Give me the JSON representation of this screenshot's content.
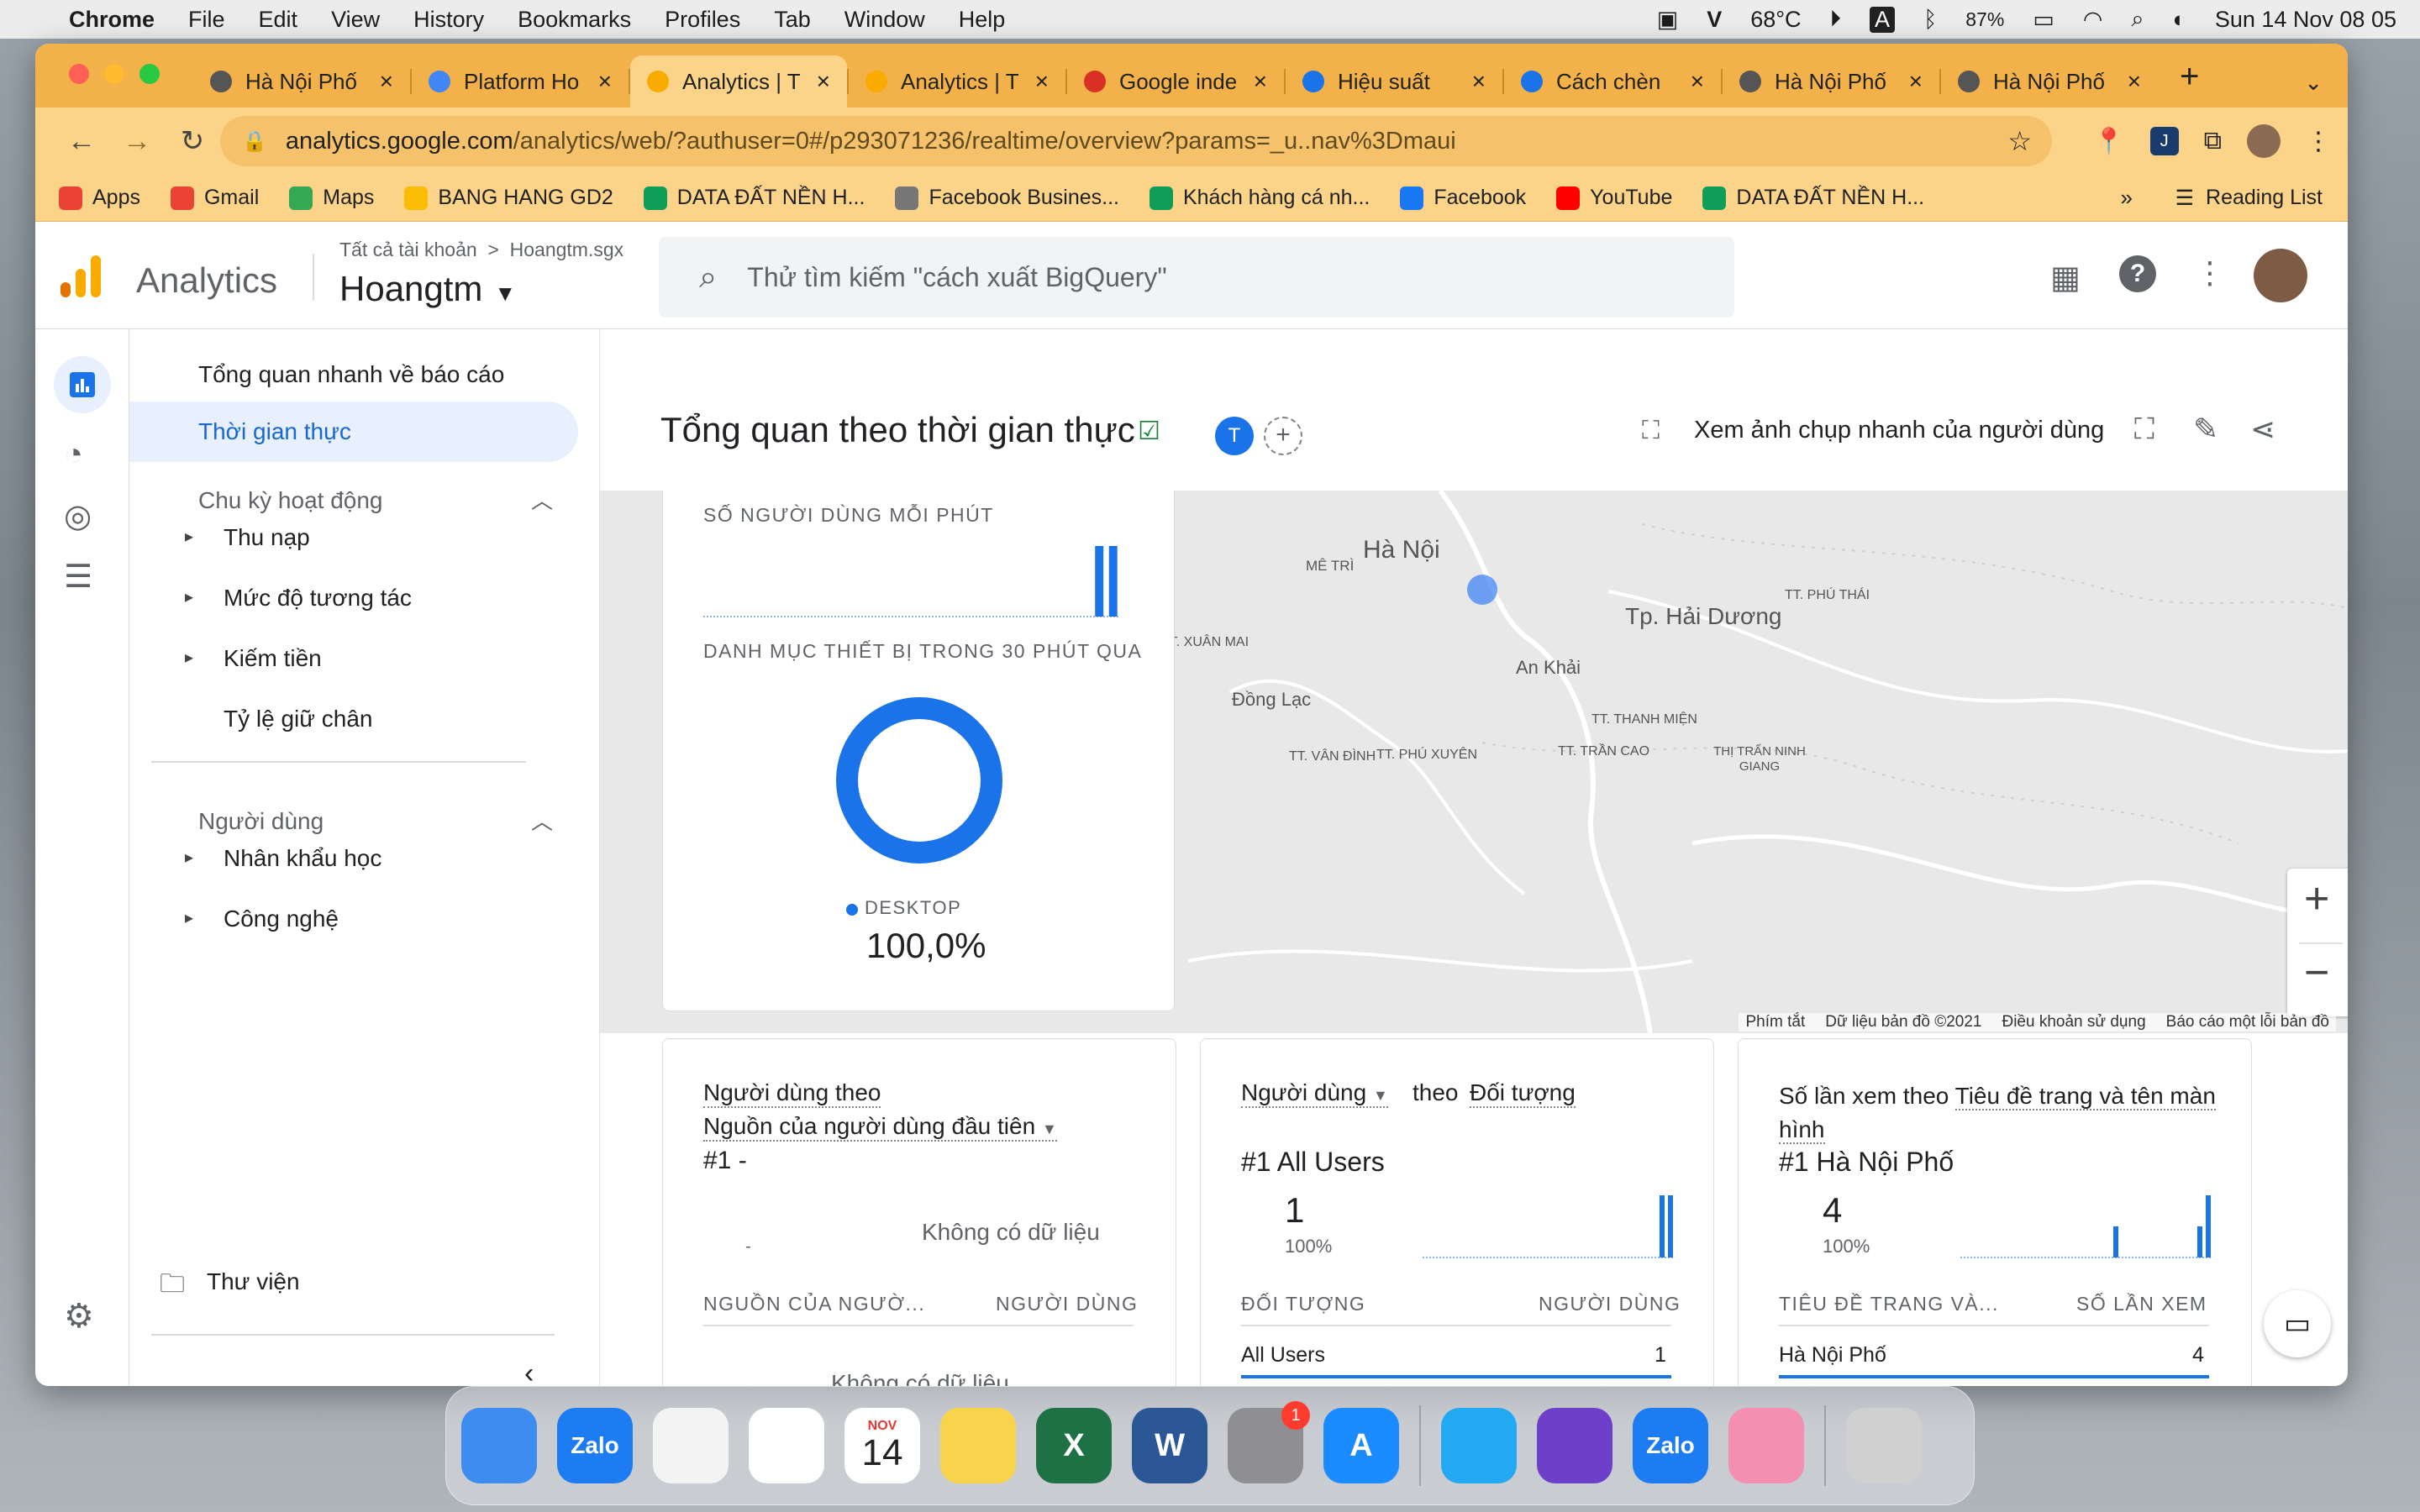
{
  "menubar": {
    "app": "Chrome",
    "items": [
      "File",
      "Edit",
      "View",
      "History",
      "Bookmarks",
      "Profiles",
      "Tab",
      "Window",
      "Help"
    ],
    "temp": "68°C",
    "battery": "87%",
    "datetime": "Sun 14 Nov  08 05"
  },
  "tabs": [
    {
      "title": "Hà Nội Phố",
      "color": "#555"
    },
    {
      "title": "Platform Ho",
      "color": "#4285f4"
    },
    {
      "title": "Analytics | T",
      "color": "#f9ab00"
    },
    {
      "title": "Analytics | T",
      "color": "#f9ab00"
    },
    {
      "title": "Google inde",
      "color": "#d93025"
    },
    {
      "title": "Hiệu suất",
      "color": "#1a73e8"
    },
    {
      "title": "Cách chèn",
      "color": "#1a73e8"
    },
    {
      "title": "Hà Nội Phố",
      "color": "#555"
    },
    {
      "title": "Hà Nội Phố",
      "color": "#555"
    }
  ],
  "url": {
    "domain": "analytics.google.com",
    "path": "/analytics/web/?authuser=0#/p293071236/realtime/overview?params=_u..nav%3Dmaui"
  },
  "bookmarks": [
    {
      "label": "Apps",
      "color": "#ea4335"
    },
    {
      "label": "Gmail",
      "color": "#ea4335"
    },
    {
      "label": "Maps",
      "color": "#34a853"
    },
    {
      "label": "BANG HANG GD2",
      "color": "#fbbc04"
    },
    {
      "label": "DATA ĐẤT NỀN H...",
      "color": "#0f9d58"
    },
    {
      "label": "Facebook Busines...",
      "color": "#777"
    },
    {
      "label": "Khách hàng cá nh...",
      "color": "#0f9d58"
    },
    {
      "label": "Facebook",
      "color": "#1877f2"
    },
    {
      "label": "YouTube",
      "color": "#ff0000"
    },
    {
      "label": "DATA ĐẤT NỀN H...",
      "color": "#0f9d58"
    }
  ],
  "reading_list": "Reading List",
  "ga": {
    "product": "Analytics",
    "breadcrumb": "Tất cả tài khoản  >  Hoangtm.sgx",
    "property": "Hoangtm",
    "search_placeholder": "Thử tìm kiếm \"cách xuất BigQuery\""
  },
  "nav": {
    "overview": "Tổng quan nhanh về báo cáo",
    "realtime": "Thời gian thực",
    "lifecycle": "Chu kỳ hoạt động",
    "acquisition": "Thu nạp",
    "engagement": "Mức độ tương tác",
    "monetization": "Kiếm tiền",
    "retention": "Tỷ lệ giữ chân",
    "users": "Người dùng",
    "demographics": "Nhân khẩu học",
    "tech": "Công nghệ",
    "library": "Thư viện"
  },
  "page": {
    "title": "Tổng quan theo thời gian thực",
    "avatar_letter": "T",
    "snapshot": "Xem ảnh chụp nhanh của người dùng"
  },
  "map": {
    "labels": [
      {
        "text": "Hà Nội",
        "size": 30
      },
      {
        "text": "MÊ TRÌ",
        "size": 17
      },
      {
        "text": "Tp. Hải Dương",
        "size": 28
      },
      {
        "text": "An Khải",
        "size": 22
      },
      {
        "text": "Đồng Lạc",
        "size": 22
      },
      {
        "text": "TT. XUÂN MAI",
        "size": 16
      },
      {
        "text": "TT. PHÚ THÁI",
        "size": 16
      },
      {
        "text": "TT. THANH MIỆN",
        "size": 16
      },
      {
        "text": "TT. VÂN ĐÌNH",
        "size": 16
      },
      {
        "text": "TT. PHÚ XUYÊN",
        "size": 16
      },
      {
        "text": "TT. TRẦN CAO",
        "size": 16
      },
      {
        "text": "THỊ TRẤN NINH GIANG",
        "size": 15
      }
    ],
    "footer": [
      "Phím tắt",
      "Dữ liệu bản đồ ©2021",
      "Điều khoản sử dụng",
      "Báo cáo một lỗi bản đồ"
    ]
  },
  "overlay": {
    "users_per_min": "SỐ NGƯỜI DÙNG MỖI PHÚT",
    "device_title": "DANH MỤC THIẾT BỊ TRONG 30 PHÚT QUA",
    "device_label": "DESKTOP",
    "device_value": "100,0%",
    "device_share": 1.0,
    "minute_bars": [
      0,
      0,
      0,
      0,
      0,
      0,
      0,
      0,
      0,
      0,
      0,
      0,
      0,
      0,
      0,
      0,
      0,
      0,
      0,
      0,
      0,
      0,
      0,
      0,
      0,
      0,
      0,
      0,
      1,
      1
    ]
  },
  "cards": [
    {
      "title_a": "Người dùng theo",
      "title_b": "Nguồn của người dùng đầu tiên",
      "rank": "#1  -",
      "empty": "Không có dữ liệu",
      "small_dash": "-",
      "col1": "NGUỒN CỦA NGƯỜ...",
      "col2": "NGƯỜI DÙNG",
      "table_empty": "Không có dữ liệu"
    },
    {
      "metric": "Người dùng",
      "dimension_prefix": "theo",
      "dimension": "Đối tượng",
      "rank": "#1  All Users",
      "value": "1",
      "pct": "100%",
      "col1": "ĐỐI TƯỢNG",
      "col2": "NGƯỜI DÙNG",
      "row_label": "All Users",
      "row_value": "1",
      "spark": [
        0,
        0,
        0,
        0,
        0,
        0,
        0,
        0,
        0,
        0,
        0,
        0,
        0,
        0,
        0,
        0,
        0,
        0,
        0,
        0,
        0,
        0,
        0,
        0,
        0,
        0,
        0,
        0,
        1,
        1
      ]
    },
    {
      "metric": "Số lần xem",
      "dimension_prefix": "theo",
      "dimension": "Tiêu đề trang và tên màn hình",
      "rank": "#1  Hà Nội Phố",
      "value": "4",
      "pct": "100%",
      "col1": "TIÊU ĐỀ TRANG VÀ...",
      "col2": "SỐ LẦN XEM",
      "row_label": "Hà Nội Phố",
      "row_value": "4",
      "spark": [
        0,
        0,
        0,
        0,
        0,
        0,
        0,
        0,
        0,
        0,
        0,
        0,
        0,
        0,
        0,
        0,
        0,
        0,
        1,
        0,
        0,
        0,
        0,
        0,
        0,
        0,
        0,
        0,
        1,
        2
      ]
    }
  ],
  "dock": [
    {
      "name": "finder",
      "color": "#3d8cf0",
      "text": ""
    },
    {
      "name": "zalo",
      "color": "#1d7cf2",
      "text": "Zalo"
    },
    {
      "name": "photos",
      "color": "#f3f3f3",
      "text": ""
    },
    {
      "name": "chrome",
      "color": "#ffffff",
      "text": ""
    },
    {
      "name": "calendar",
      "color": "#ffffff",
      "text": "14"
    },
    {
      "name": "notes",
      "color": "#f8d44c",
      "text": ""
    },
    {
      "name": "excel",
      "color": "#1e7145",
      "text": "X"
    },
    {
      "name": "word",
      "color": "#2b5797",
      "text": "W"
    },
    {
      "name": "system-preferences",
      "color": "#8e8e93",
      "text": ""
    },
    {
      "name": "app-store",
      "color": "#1a8cff",
      "text": "A"
    },
    {
      "name": "vscode",
      "color": "#23a9f2",
      "text": ""
    },
    {
      "name": "github-desktop",
      "color": "#6e40c9",
      "text": ""
    },
    {
      "name": "zalo-2",
      "color": "#1d7cf2",
      "text": "Zalo"
    },
    {
      "name": "pink-app",
      "color": "#f48fb1",
      "text": ""
    },
    {
      "name": "trash",
      "color": "#d0d0d0",
      "text": ""
    }
  ],
  "calendar_month": "NOV",
  "badge": "1"
}
